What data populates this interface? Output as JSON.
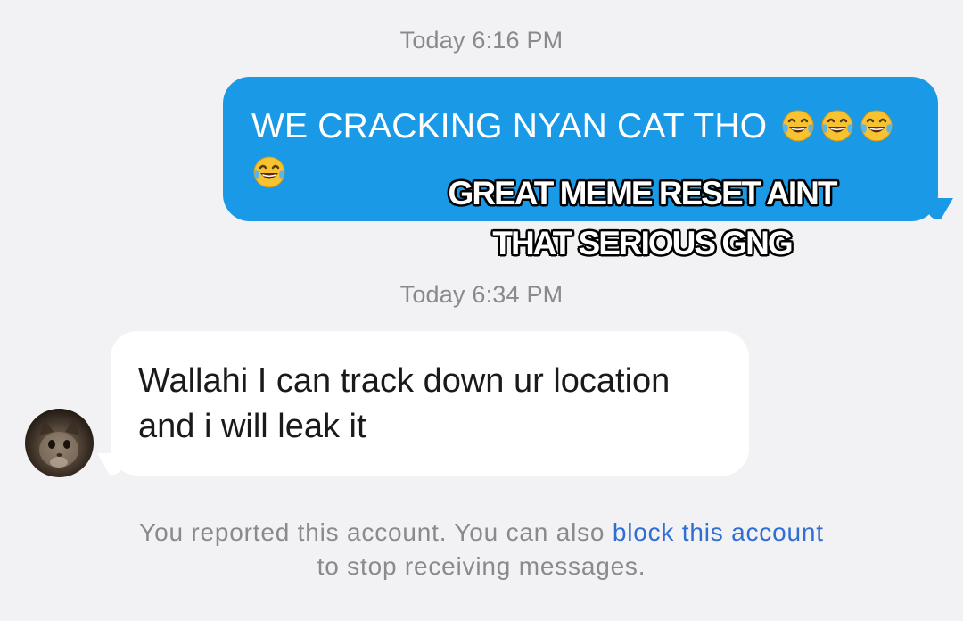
{
  "conversation": {
    "timestamp_1": "Today 6:16 PM",
    "timestamp_2": "Today 6:34 PM",
    "outgoing_message": {
      "text": "WE CRACKING NYAN CAT THO",
      "emojis": [
        "face-with-tears-of-joy",
        "face-with-tears-of-joy",
        "face-with-tears-of-joy",
        "face-with-tears-of-joy"
      ],
      "bubble_color": "#1a99e6"
    },
    "incoming_message": {
      "line_1": "Wallahi I can track down ur location",
      "line_2": "and i will leak it",
      "bubble_color": "#ffffff"
    },
    "sender_avatar": "cat-avatar"
  },
  "meme_overlay": {
    "line_1": "GREAT MEME RESET AINT",
    "line_2": "THAT SERIOUS GNG"
  },
  "footer": {
    "text_before": "You reported this account. You can also ",
    "link_text": "block this account",
    "text_after": " to stop receiving messages.",
    "link_color": "#2f6ed3"
  }
}
